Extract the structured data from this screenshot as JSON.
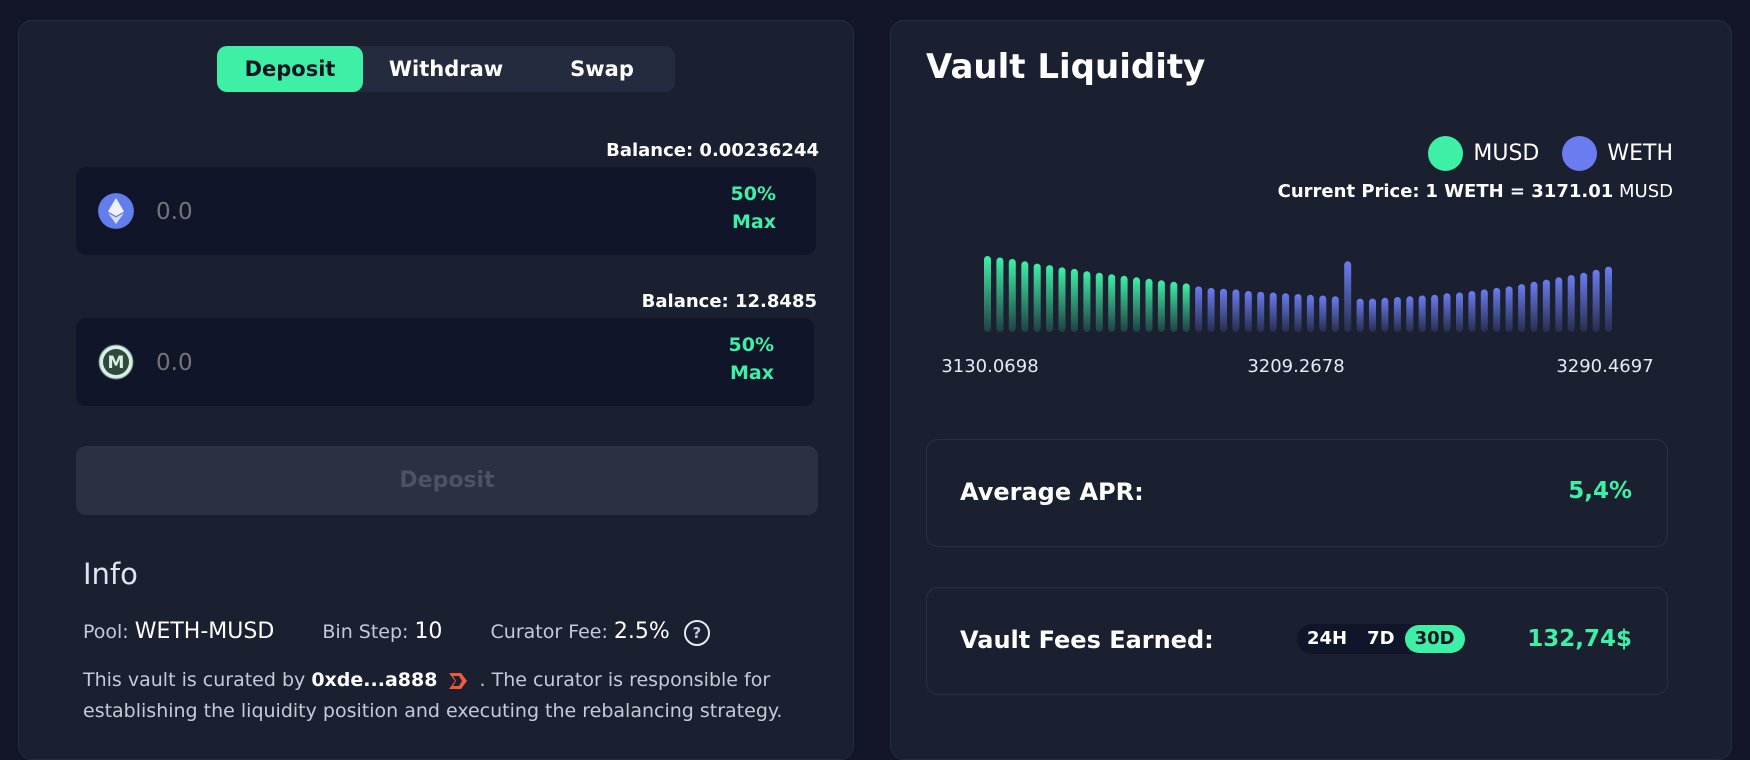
{
  "tabs": [
    {
      "label": "Deposit",
      "active": true
    },
    {
      "label": "Withdraw",
      "active": false
    },
    {
      "label": "Swap",
      "active": false
    }
  ],
  "token_a": {
    "balance": "Balance: 0.00236244",
    "placeholder": "0.0",
    "pct": "50%",
    "max": "Max",
    "icon": "eth-icon"
  },
  "token_b": {
    "balance": "Balance: 12.8485",
    "placeholder": "0.0",
    "pct": "50%",
    "max": "Max",
    "icon": "musd-icon"
  },
  "deposit_button": "Deposit",
  "info": {
    "title": "Info",
    "pool_label": "Pool:",
    "pool_value": "WETH-MUSD",
    "bin_label": "Bin Step:",
    "bin_value": "10",
    "fee_label": "Curator Fee:",
    "fee_value": "2.5%",
    "text_pre": "This vault is curated by",
    "curator": "0xde...a888",
    "text_line1_post": ". The curator is responsible for",
    "text_line2": "establishing the liquidity position and executing the rebalancing strategy."
  },
  "vault": {
    "title": "Vault Liquidity",
    "legend": [
      {
        "label": "MUSD",
        "color": "#3ef0a6"
      },
      {
        "label": "WETH",
        "color": "#6b7cf0"
      }
    ],
    "current_price_label": "Current Price:",
    "current_price_value": "1 WETH = 3171.01",
    "current_price_unit": "MUSD",
    "apr_label": "Average APR:",
    "apr_value": "5,4%",
    "fees_label": "Vault Fees Earned:",
    "fees_periods": [
      {
        "label": "24H",
        "active": false
      },
      {
        "label": "7D",
        "active": false
      },
      {
        "label": "30D",
        "active": true
      }
    ],
    "fees_value": "132,74$"
  },
  "chart_data": {
    "type": "bar",
    "title": "",
    "xlabel": "",
    "ylabel": "",
    "tick_labels": [
      "3130.0698",
      "3209.2678",
      "3290.4697"
    ],
    "series": [
      {
        "name": "MUSD",
        "color": "#3ef0a6",
        "values": [
          1.0,
          0.98,
          0.96,
          0.93,
          0.9,
          0.88,
          0.85,
          0.83,
          0.8,
          0.78,
          0.76,
          0.74,
          0.72,
          0.7,
          0.68,
          0.66,
          0.64,
          0.0,
          0.0,
          0.0,
          0.0,
          0.0,
          0.0,
          0.0,
          0.0,
          0.0,
          0.0,
          0.0,
          0.0,
          0.0,
          0.0,
          0.0,
          0.0,
          0.0,
          0.0,
          0.0,
          0.0,
          0.0,
          0.0,
          0.0,
          0.0,
          0.0,
          0.0,
          0.0,
          0.0,
          0.0,
          0.0,
          0.0,
          0.0,
          0.0,
          0.0
        ]
      },
      {
        "name": "WETH",
        "color": "#6b7cf0",
        "values": [
          0.0,
          0.0,
          0.0,
          0.0,
          0.0,
          0.0,
          0.0,
          0.0,
          0.0,
          0.0,
          0.0,
          0.0,
          0.0,
          0.0,
          0.0,
          0.0,
          0.0,
          0.6,
          0.58,
          0.57,
          0.56,
          0.54,
          0.53,
          0.52,
          0.51,
          0.5,
          0.49,
          0.48,
          0.47,
          0.93,
          0.44,
          0.44,
          0.45,
          0.46,
          0.47,
          0.48,
          0.49,
          0.51,
          0.52,
          0.54,
          0.56,
          0.58,
          0.6,
          0.63,
          0.66,
          0.69,
          0.72,
          0.75,
          0.78,
          0.82,
          0.86
        ]
      }
    ]
  }
}
